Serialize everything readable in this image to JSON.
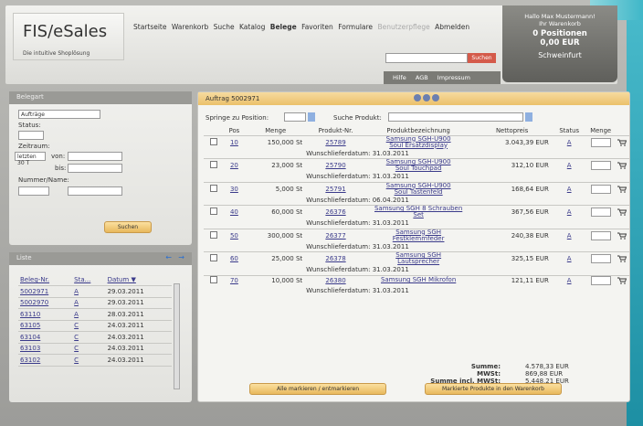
{
  "app": {
    "logo": "FIS/eSales",
    "tagline": "Die intuitive Shoplösung"
  },
  "nav": [
    "Startseite",
    "Warenkorb",
    "Suche",
    "Katalog",
    "Belege",
    "Favoriten",
    "Formulare",
    "Benutzerpflege",
    "Abmelden"
  ],
  "nav_active": "Belege",
  "user": {
    "greeting1": "Hallo Max Mustermann!",
    "greeting2": "Ihr Warenkorb",
    "positions": "0 Positionen",
    "amount": "0,00 EUR",
    "city": "Schweinfurt"
  },
  "search": {
    "button": "Suchen"
  },
  "subnav": [
    "Hilfe",
    "AGB",
    "Impressum"
  ],
  "left": {
    "title": "Belegart",
    "type_value": "Aufträge",
    "status_label": "Status:",
    "zeitraum_label": "Zeitraum:",
    "zeitraum_value": "letzten 30 T",
    "von_label": "von:",
    "bis_label": "bis:",
    "nummer_label": "Nummer/Name:",
    "button": "Suchen"
  },
  "list": {
    "title": "Liste",
    "cols": [
      "Beleg-Nr.",
      "Sta...",
      "Datum ▼"
    ],
    "rows": [
      [
        "5002971",
        "A",
        "29.03.2011"
      ],
      [
        "5002970",
        "A",
        "29.03.2011"
      ],
      [
        "63110",
        "A",
        "28.03.2011"
      ],
      [
        "63105",
        "C",
        "24.03.2011"
      ],
      [
        "63104",
        "C",
        "24.03.2011"
      ],
      [
        "63103",
        "C",
        "24.03.2011"
      ],
      [
        "63102",
        "C",
        "24.03.2011"
      ]
    ]
  },
  "order": {
    "title": "Auftrag 5002971",
    "springe": "Springe zu Position:",
    "suche": "Suche Produkt:",
    "cols": [
      "Pos",
      "Menge",
      "Produkt-Nr.",
      "Produktbezeichnung",
      "Nettopreis",
      "Status",
      "Menge"
    ],
    "wunsch_label": "Wunschlieferdatum:",
    "items": [
      {
        "pos": "10",
        "menge": "150,000 St",
        "nr": "25789",
        "bez1": "Samsung SGH-U900",
        "bez2": "Soul Ersatzdisplay",
        "preis": "3.043,39 EUR",
        "status": "A",
        "wunsch": "31.03.2011"
      },
      {
        "pos": "20",
        "menge": "23,000 St",
        "nr": "25790",
        "bez1": "Samsung SGH-U900",
        "bez2": "Soul Touchpad",
        "preis": "312,10 EUR",
        "status": "A",
        "wunsch": "31.03.2011"
      },
      {
        "pos": "30",
        "menge": "5,000 St",
        "nr": "25791",
        "bez1": "Samsung SGH-U900",
        "bez2": "Soul Tastenfeld",
        "preis": "168,64 EUR",
        "status": "A",
        "wunsch": "06.04.2011"
      },
      {
        "pos": "40",
        "menge": "60,000 St",
        "nr": "26376",
        "bez1": "Samsung SGH 8 Schrauben",
        "bez2": "Set",
        "preis": "367,56 EUR",
        "status": "A",
        "wunsch": "31.03.2011"
      },
      {
        "pos": "50",
        "menge": "300,000 St",
        "nr": "26377",
        "bez1": "Samsung SGH",
        "bez2": "Festklemmfeder",
        "preis": "240,38 EUR",
        "status": "A",
        "wunsch": "31.03.2011"
      },
      {
        "pos": "60",
        "menge": "25,000 St",
        "nr": "26378",
        "bez1": "Samsung SGH",
        "bez2": "Lautsprecher",
        "preis": "325,15 EUR",
        "status": "A",
        "wunsch": "31.03.2011"
      },
      {
        "pos": "70",
        "menge": "10,000 St",
        "nr": "26380",
        "bez1": "Samsung SGH Mikrofon",
        "bez2": "",
        "preis": "121,11 EUR",
        "status": "A",
        "wunsch": "31.03.2011"
      }
    ],
    "summe_label": "Summe:",
    "summe": "4.578,33 EUR",
    "mwst_label": "MWSt:",
    "mwst": "869,88 EUR",
    "incl_label": "Summe incl. MWSt:",
    "incl": "5.448,21 EUR",
    "btn_mark": "Alle markieren / entmarkieren",
    "btn_cart": "Markierte Produkte in den Warenkorb"
  }
}
